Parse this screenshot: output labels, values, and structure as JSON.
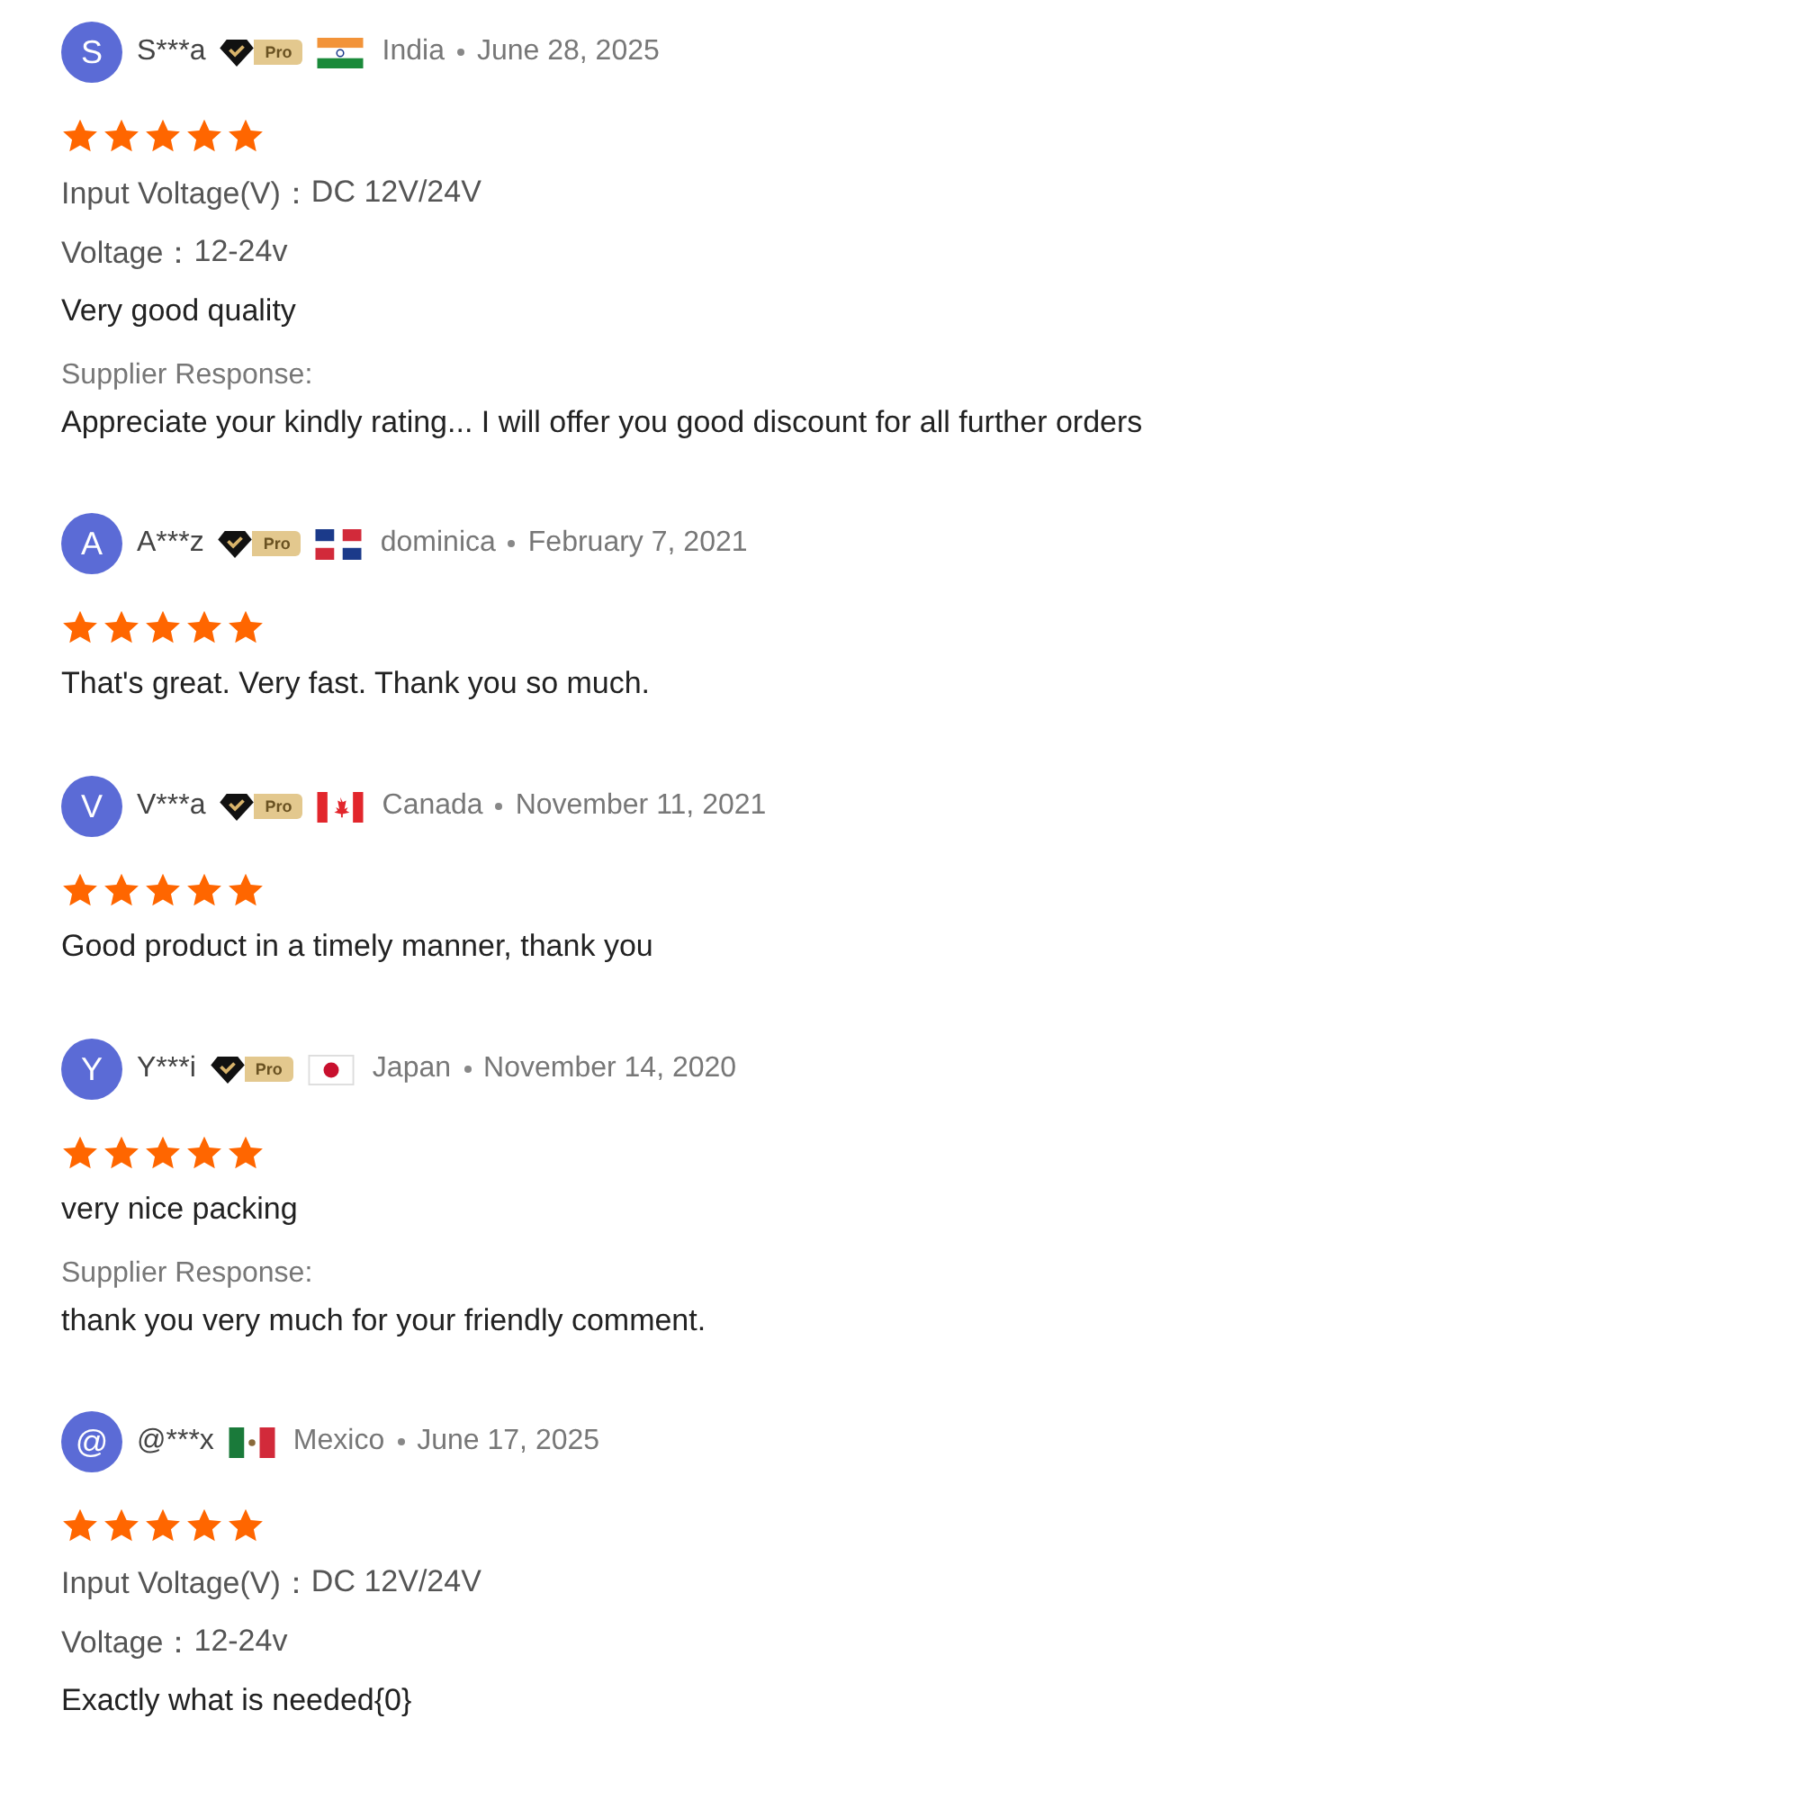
{
  "reviews": [
    {
      "initial": "S",
      "name": "S***a",
      "badge": "Pro",
      "flag": {
        "kind": "in"
      },
      "country": "India",
      "date": "June 28, 2025",
      "stars": 5,
      "specs": [
        {
          "label": "Input Voltage(V)：",
          "value": "DC 12V/24V"
        },
        {
          "label": "Voltage：",
          "value": "12-24v"
        }
      ],
      "text": "Very good quality",
      "response": {
        "label": "Supplier Response:",
        "text": "Appreciate your kindly rating... I will offer you good discount for all further orders"
      }
    },
    {
      "initial": "A",
      "name": "A***z",
      "badge": "Pro",
      "flag": {
        "kind": "do"
      },
      "country": "dominica",
      "date": "February 7, 2021",
      "stars": 5,
      "text": "That's great. Very fast. Thank you so much."
    },
    {
      "initial": "V",
      "name": "V***a",
      "badge": "Pro",
      "flag": {
        "kind": "ca"
      },
      "country": "Canada",
      "date": "November 11, 2021",
      "stars": 5,
      "text": "Good product in a timely manner, thank you"
    },
    {
      "initial": "Y",
      "name": "Y***i",
      "badge": "Pro",
      "flag": {
        "kind": "jp"
      },
      "country": "Japan",
      "date": "November 14, 2020",
      "stars": 5,
      "text": "very nice packing",
      "response": {
        "label": "Supplier Response:",
        "text": "thank you very much for your friendly comment."
      }
    },
    {
      "initial": "@",
      "name": "@***x",
      "flag": {
        "kind": "mx"
      },
      "country": "Mexico",
      "date": "June 17, 2025",
      "stars": 5,
      "specs": [
        {
          "label": "Input Voltage(V)：",
          "value": "DC 12V/24V"
        },
        {
          "label": "Voltage：",
          "value": "12-24v"
        }
      ],
      "text": "Exactly what is needed{0}"
    }
  ]
}
